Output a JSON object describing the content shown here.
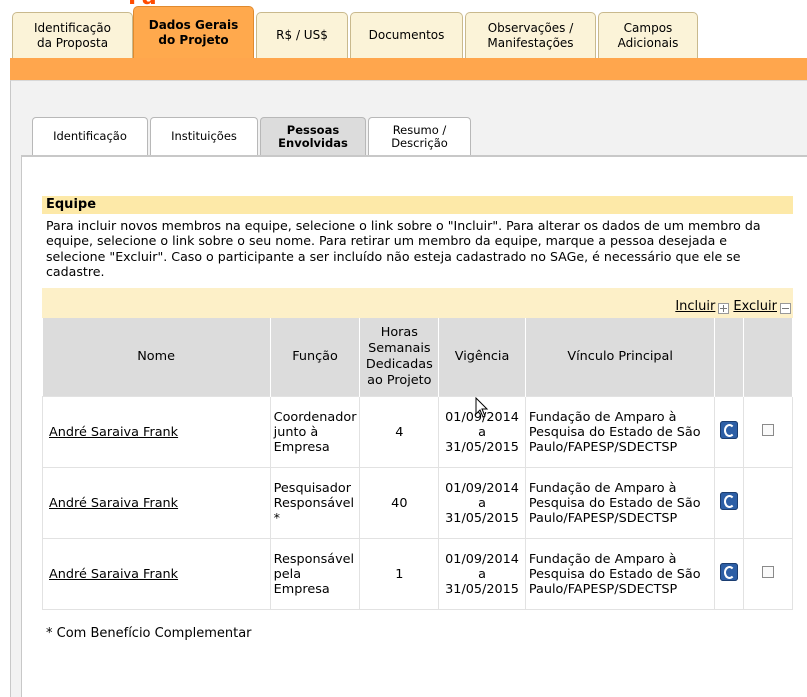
{
  "page": {
    "top_fragment": "Fa"
  },
  "main_tabs": [
    {
      "label": "Identificação\nda Proposta",
      "active": false
    },
    {
      "label": "Dados Gerais\ndo Projeto",
      "active": true
    },
    {
      "label": "R$ / US$",
      "active": false
    },
    {
      "label": "Documentos",
      "active": false
    },
    {
      "label": "Observações /\nManifestações",
      "active": false
    },
    {
      "label": "Campos\nAdicionais",
      "active": false
    }
  ],
  "sub_tabs": [
    {
      "label": "Identificação",
      "active": false
    },
    {
      "label": "Instituições",
      "active": false
    },
    {
      "label": "Pessoas\nEnvolvidas",
      "active": true
    },
    {
      "label": "Resumo /\nDescrição",
      "active": false
    }
  ],
  "equipe": {
    "title": "Equipe",
    "description": "Para incluir novos membros na equipe, selecione o link sobre o \"Incluir\". Para alterar os dados de um membro da equipe, selecione o link sobre o seu nome. Para retirar um membro da equipe, marque a pessoa desejada e selecione \"Excluir\". Caso o participante a ser incluído não esteja cadastrado no SAGe, é necessário que ele se cadastre.",
    "incluir_label": "Incluir",
    "excluir_label": "Excluir"
  },
  "table": {
    "headers": {
      "nome": "Nome",
      "funcao": "Função",
      "horas": "Horas Semanais Dedicadas ao Projeto",
      "vigencia": "Vigência",
      "vinculo": "Vínculo Principal"
    },
    "rows": [
      {
        "nome": "André Saraiva Frank",
        "funcao": "Coordenador junto à Empresa",
        "horas": "4",
        "vigencia": "01/09/2014 a 31/05/2015",
        "vinculo": "Fundação de Amparo à Pesquisa do Estado de São Paulo/FAPESP/SDECTSP",
        "has_checkbox": true
      },
      {
        "nome": "André Saraiva Frank",
        "funcao": "Pesquisador Responsável *",
        "horas": "40",
        "vigencia": "01/09/2014 a 31/05/2015",
        "vinculo": "Fundação de Amparo à Pesquisa do Estado de São Paulo/FAPESP/SDECTSP",
        "has_checkbox": false
      },
      {
        "nome": "André Saraiva Frank",
        "funcao": "Responsável pela Empresa",
        "horas": "1",
        "vigencia": "01/09/2014 a 31/05/2015",
        "vinculo": "Fundação de Amparo à Pesquisa do Estado de São Paulo/FAPESP/SDECTSP",
        "has_checkbox": true
      }
    ]
  },
  "footnote": "* Com Benefício Complementar",
  "colors": {
    "active_tab": "#ffa94d",
    "inactive_tab": "#fbf3d8",
    "orange_bar": "#ffa64d",
    "equipe_header": "#fde9a8",
    "actions_bar": "#fdf0c8",
    "table_header": "#dcdcdc",
    "title_red": "#ff4c00"
  },
  "icons": {
    "vinculo_action": "document-view-icon",
    "cursor": "mouse-cursor-icon"
  }
}
